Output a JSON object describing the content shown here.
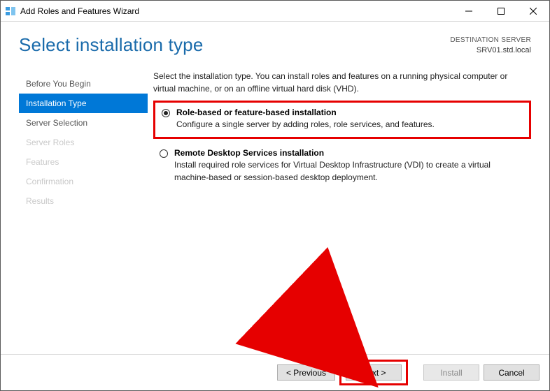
{
  "titlebar": {
    "title": "Add Roles and Features Wizard"
  },
  "header": {
    "heading": "Select installation type",
    "dest_label": "DESTINATION SERVER",
    "dest_value": "SRV01.std.local"
  },
  "sidebar": {
    "steps": [
      {
        "label": "Before You Begin",
        "state": "normal"
      },
      {
        "label": "Installation Type",
        "state": "active"
      },
      {
        "label": "Server Selection",
        "state": "normal"
      },
      {
        "label": "Server Roles",
        "state": "disabled"
      },
      {
        "label": "Features",
        "state": "disabled"
      },
      {
        "label": "Confirmation",
        "state": "disabled"
      },
      {
        "label": "Results",
        "state": "disabled"
      }
    ]
  },
  "main": {
    "intro": "Select the installation type. You can install roles and features on a running physical computer or virtual machine, or on an offline virtual hard disk (VHD).",
    "options": [
      {
        "title": "Role-based or feature-based installation",
        "desc": "Configure a single server by adding roles, role services, and features.",
        "checked": true
      },
      {
        "title": "Remote Desktop Services installation",
        "desc": "Install required role services for Virtual Desktop Infrastructure (VDI) to create a virtual machine-based or session-based desktop deployment.",
        "checked": false
      }
    ]
  },
  "footer": {
    "previous": "< Previous",
    "next": "Next >",
    "install": "Install",
    "cancel": "Cancel"
  }
}
